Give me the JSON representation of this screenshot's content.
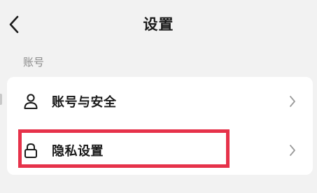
{
  "header": {
    "title": "设置",
    "back_icon": "chevron-left-icon"
  },
  "section": {
    "label": "账号"
  },
  "settings_list": [
    {
      "label": "账号与安全",
      "icon": "user-icon",
      "chevron": "chevron-right-icon"
    },
    {
      "label": "隐私设置",
      "icon": "lock-icon",
      "chevron": "chevron-right-icon",
      "highlighted": true
    }
  ],
  "colors": {
    "background": "#f2f2f2",
    "card": "#ffffff",
    "highlight": "#e6324a",
    "section_label": "#8a8a8a",
    "text": "#1a1a1a"
  }
}
